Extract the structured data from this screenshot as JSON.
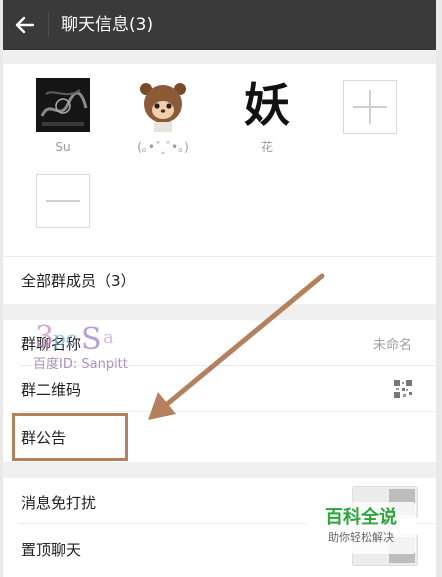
{
  "header": {
    "title": "聊天信息(3)"
  },
  "members": [
    {
      "name": "Su"
    },
    {
      "name": "(｡•ˇ‸ˇ•｡)"
    },
    {
      "name": "花",
      "avatar_text": "妖"
    }
  ],
  "all_members_label": "全部群成员（3）",
  "settings": {
    "group_name_label": "群聊名称",
    "group_name_value": "未命名",
    "qr_label": "群二维码",
    "announcement_label": "群公告"
  },
  "toggles": {
    "mute_label": "消息免打扰",
    "pin_label": "置顶聊天"
  },
  "watermark": {
    "text": "百度ID: Sanpitt"
  },
  "baike": {
    "title": "百科全说",
    "subtitle": "助你轻松解决"
  },
  "colors": {
    "highlight": "#b5805c",
    "topbar": "#3a3a3a",
    "baike_green": "#2aa73a"
  },
  "icons": [
    "back-arrow-icon",
    "add-member-icon",
    "remove-member-icon",
    "qr-code-icon"
  ]
}
